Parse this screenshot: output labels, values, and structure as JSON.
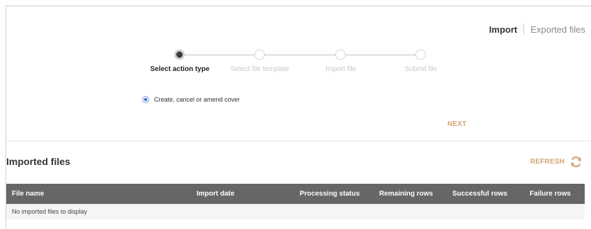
{
  "top_tabs": {
    "import": "Import",
    "exported": "Exported files"
  },
  "stepper": {
    "steps": [
      {
        "label": "Select action type",
        "active": true
      },
      {
        "label": "Select file template",
        "active": false
      },
      {
        "label": "Import file",
        "active": false
      },
      {
        "label": "Submit file",
        "active": false
      }
    ]
  },
  "action": {
    "option_label": "Create, cancel or amend cover",
    "selected": true
  },
  "buttons": {
    "next": "NEXT",
    "refresh": "REFRESH"
  },
  "imported_files": {
    "title": "Imported files",
    "columns": [
      "File name",
      "Import date",
      "Processing status",
      "Remaining rows",
      "Successful rows",
      "Failure rows"
    ],
    "empty_message": "No imported files to display"
  },
  "colors": {
    "accent": "#d4a574",
    "header_bg": "#666666",
    "active_step": "#3a3a3a",
    "radio": "#2f66c8"
  },
  "icons": {
    "refresh": "refresh-icon"
  }
}
